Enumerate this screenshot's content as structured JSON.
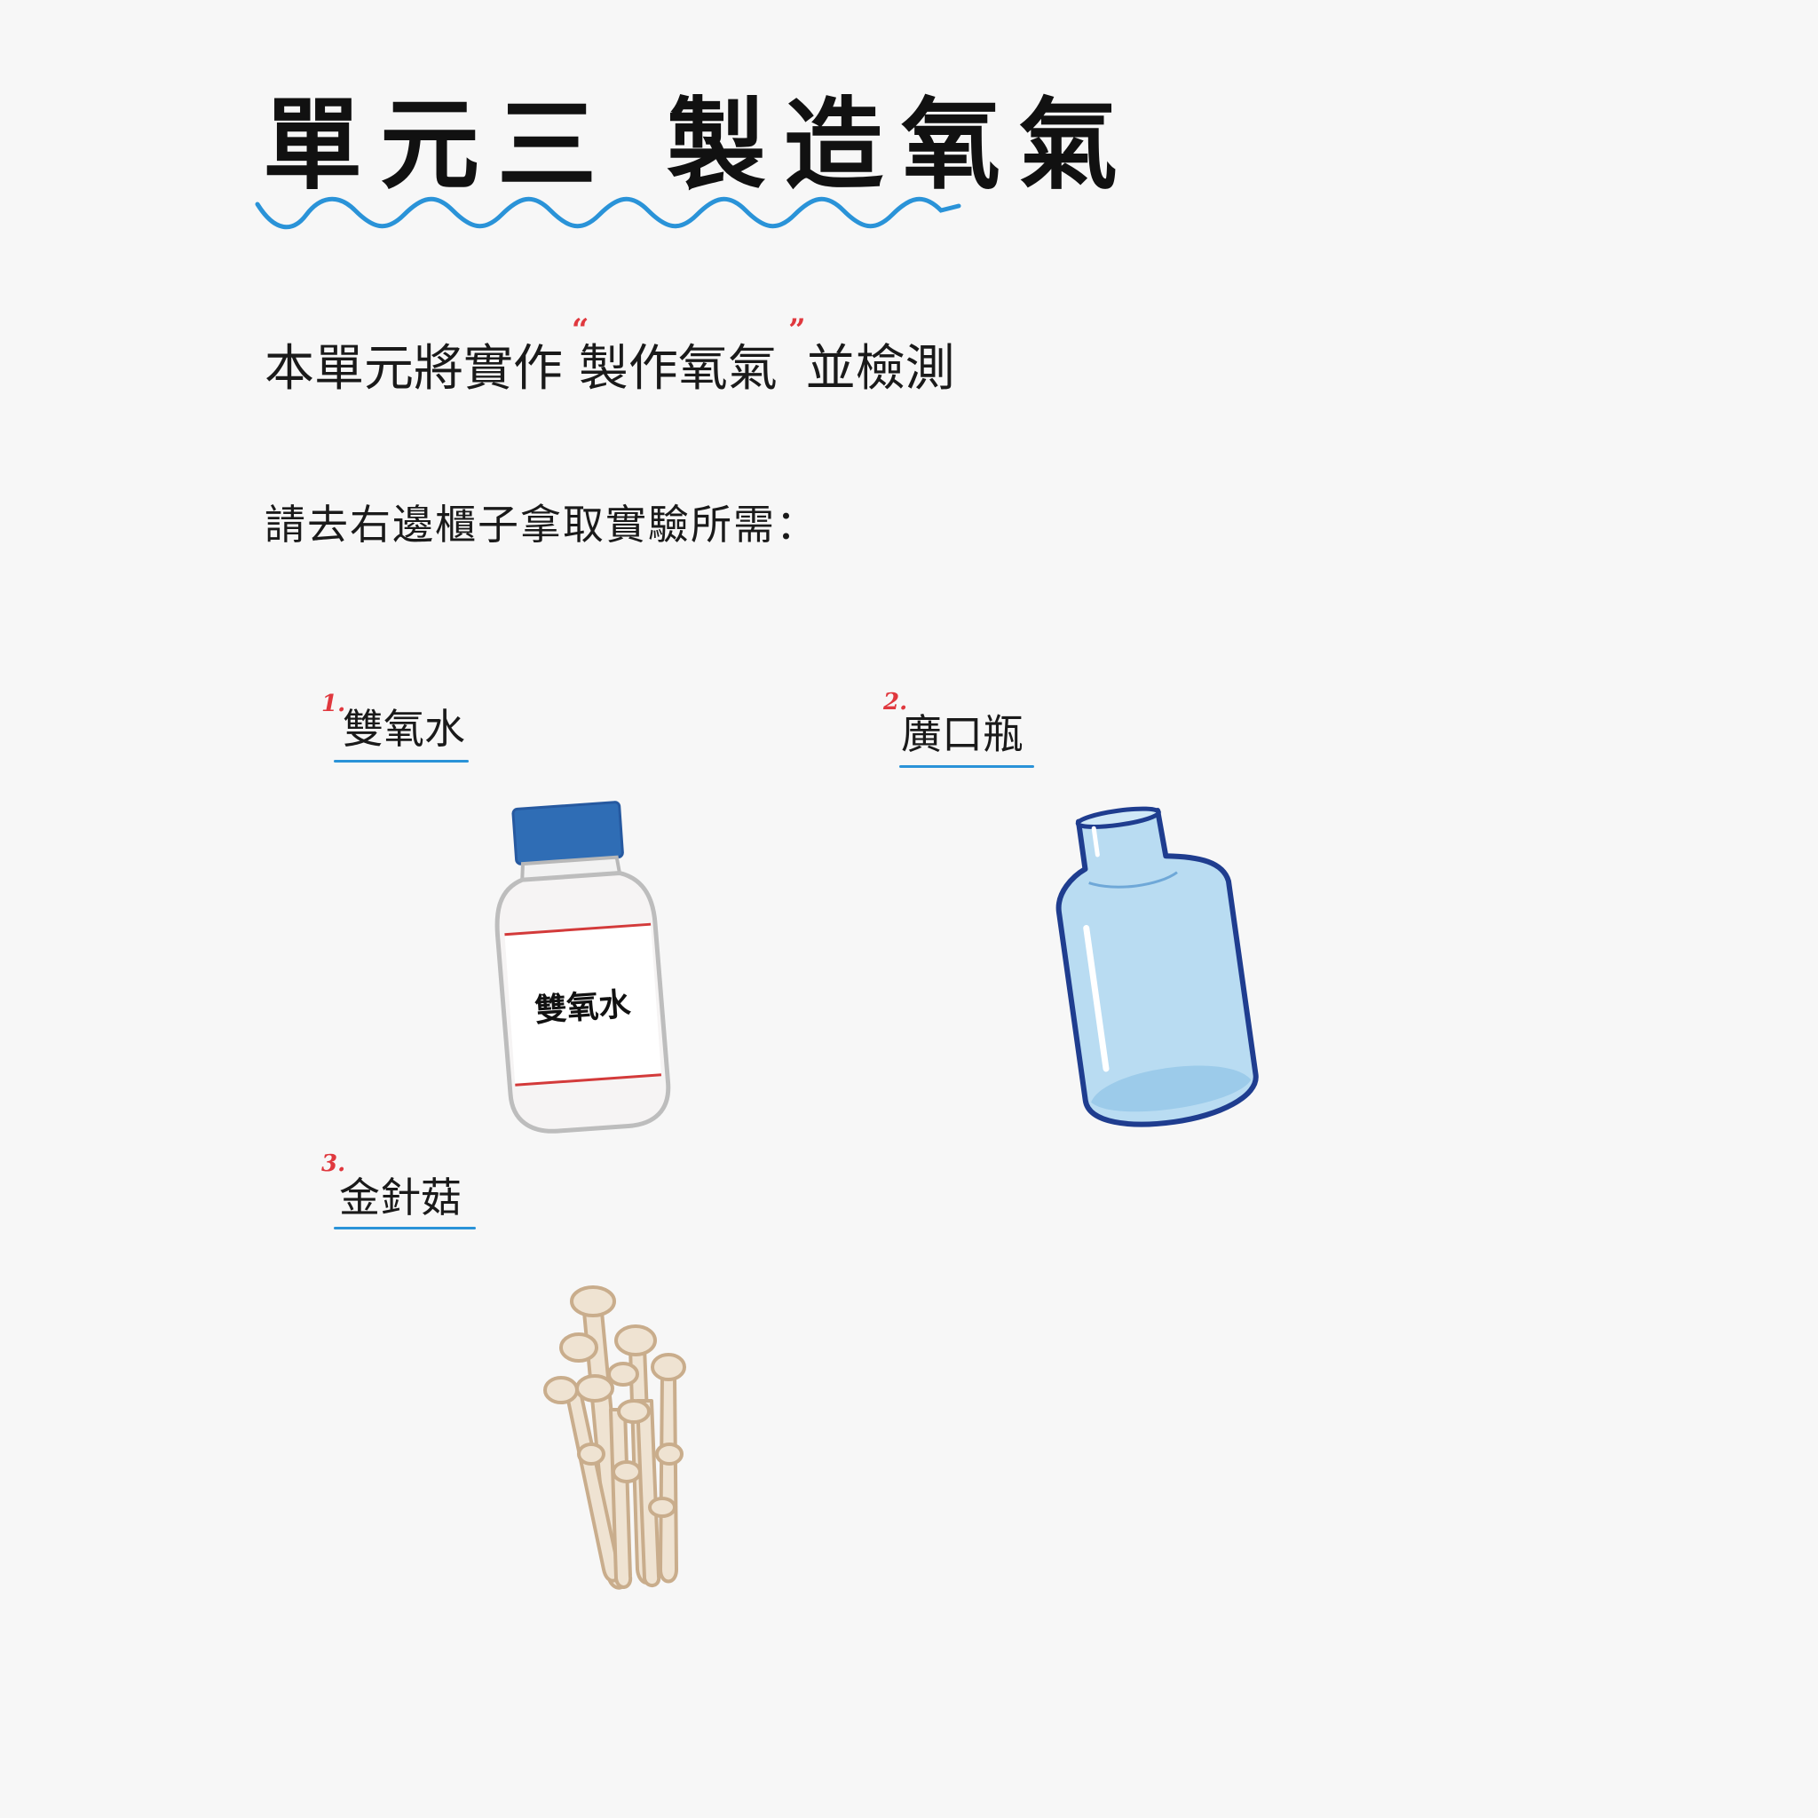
{
  "title": "單元三 製造氧氣",
  "intro": {
    "before": "本單元將實作",
    "quoted": "製作氧氣",
    "after": "並檢測",
    "open_mark": "“",
    "close_mark": "”"
  },
  "instruction": "請去右邊櫃子拿取實驗所需：",
  "items": [
    {
      "number": "1.",
      "label": "雙氧水",
      "bottle_label": "雙氧水",
      "icon": "hydrogen-peroxide-bottle-icon"
    },
    {
      "number": "2.",
      "label": "廣口瓶",
      "icon": "wide-mouth-jar-icon"
    },
    {
      "number": "3.",
      "label": "金針菇",
      "icon": "enoki-mushroom-icon"
    }
  ],
  "colors": {
    "background": "#f7f7f7",
    "accent_blue": "#2a93d8",
    "accent_red": "#e0383e",
    "cap_blue": "#2f6db5",
    "jar_fill": "#b9dcf2",
    "jar_outline": "#1f3d8f",
    "mushroom_fill": "#efe3d2",
    "mushroom_outline": "#c9ad8c"
  }
}
